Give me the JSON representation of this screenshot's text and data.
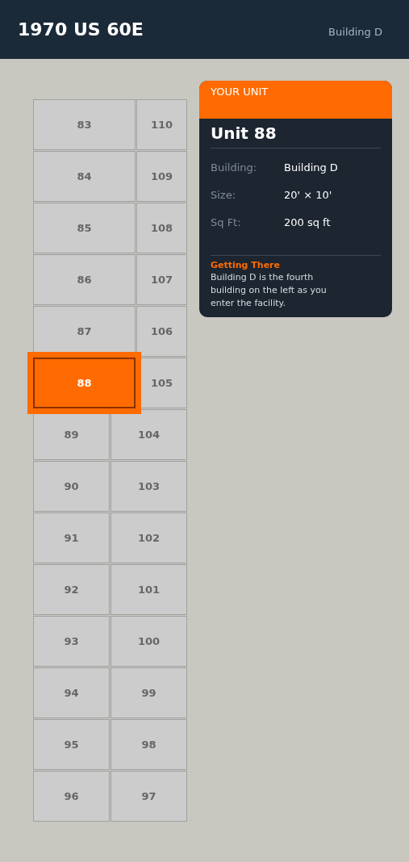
{
  "header": {
    "title": "1970 US 60E",
    "building": "Building D"
  },
  "rows": [
    {
      "kind": "wide",
      "units": [
        {
          "label": "83",
          "selected": false
        },
        {
          "label": "110",
          "selected": false
        }
      ]
    },
    {
      "kind": "wide",
      "units": [
        {
          "label": "84",
          "selected": false
        },
        {
          "label": "109",
          "selected": false
        }
      ]
    },
    {
      "kind": "wide",
      "units": [
        {
          "label": "85",
          "selected": false
        },
        {
          "label": "108",
          "selected": false
        }
      ]
    },
    {
      "kind": "wide",
      "units": [
        {
          "label": "86",
          "selected": false
        },
        {
          "label": "107",
          "selected": false
        }
      ]
    },
    {
      "kind": "wide",
      "units": [
        {
          "label": "87",
          "selected": false
        },
        {
          "label": "106",
          "selected": false
        }
      ]
    },
    {
      "kind": "wide",
      "units": [
        {
          "label": "88",
          "selected": true
        },
        {
          "label": "105",
          "selected": false
        }
      ]
    },
    {
      "kind": "even",
      "units": [
        {
          "label": "89",
          "selected": false
        },
        {
          "label": "104",
          "selected": false
        }
      ]
    },
    {
      "kind": "even",
      "units": [
        {
          "label": "90",
          "selected": false
        },
        {
          "label": "103",
          "selected": false
        }
      ]
    },
    {
      "kind": "even",
      "units": [
        {
          "label": "91",
          "selected": false
        },
        {
          "label": "102",
          "selected": false
        }
      ]
    },
    {
      "kind": "even",
      "units": [
        {
          "label": "92",
          "selected": false
        },
        {
          "label": "101",
          "selected": false
        }
      ]
    },
    {
      "kind": "even",
      "units": [
        {
          "label": "93",
          "selected": false
        },
        {
          "label": "100",
          "selected": false
        }
      ]
    },
    {
      "kind": "even",
      "units": [
        {
          "label": "94",
          "selected": false
        },
        {
          "label": "99",
          "selected": false
        }
      ]
    },
    {
      "kind": "even",
      "units": [
        {
          "label": "95",
          "selected": false
        },
        {
          "label": "98",
          "selected": false
        }
      ]
    },
    {
      "kind": "even",
      "units": [
        {
          "label": "96",
          "selected": false
        },
        {
          "label": "97",
          "selected": false
        }
      ]
    }
  ],
  "card": {
    "eyebrow": "YOUR UNIT",
    "title": "Unit 88",
    "details": [
      {
        "label": "Building:",
        "value": "Building D"
      },
      {
        "label": "Size:",
        "value": "20' × 10'"
      },
      {
        "label": "Sq Ft:",
        "value": "200 sq ft"
      }
    ],
    "directions_heading": "Getting There",
    "directions": "Building D is the fourth building on the left as you enter the facility."
  }
}
